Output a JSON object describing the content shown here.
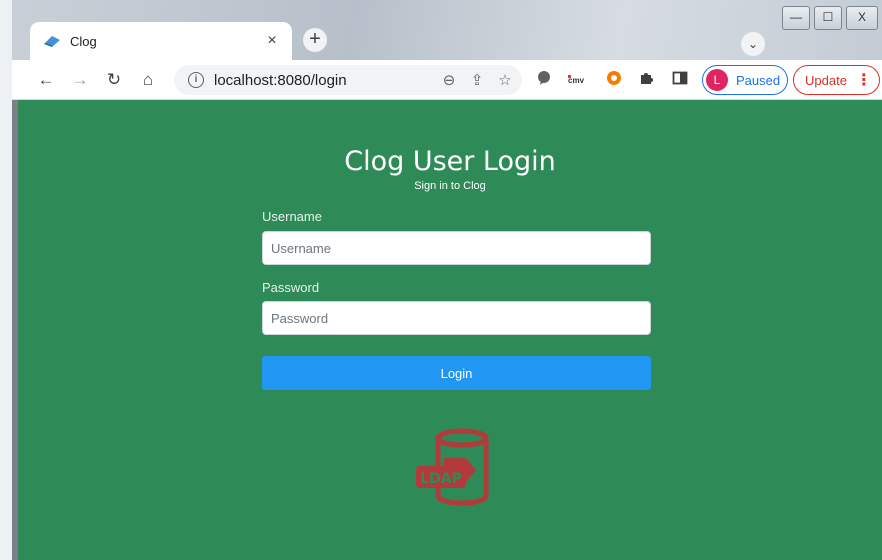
{
  "browser": {
    "tab_title": "Clog",
    "tab_close": "×",
    "new_tab": "+",
    "tab_search": "⌄",
    "window_controls": {
      "minimize": "—",
      "maximize": "☐",
      "close": "X"
    },
    "url": "localhost:8080/login",
    "profile": {
      "initial": "L",
      "label": "Paused"
    },
    "update_label": "Update",
    "icons": [
      "back-icon",
      "forward-icon",
      "reload-icon",
      "home-icon",
      "info-icon",
      "zoom-out-icon",
      "share-icon",
      "bookmark-star-icon",
      "extensions-icon",
      "side-panel-icon",
      "menu-icon"
    ]
  },
  "page": {
    "title": "Clog User Login",
    "subtitle": "Sign in to Clog",
    "username": {
      "label": "Username",
      "placeholder": "Username",
      "value": ""
    },
    "password": {
      "label": "Password",
      "placeholder": "Password",
      "value": ""
    },
    "login_label": "Login",
    "logo_text": "LDAP",
    "colors": {
      "background": "#2e8b57",
      "button": "#2196f3",
      "logo": "#b23a3a"
    }
  }
}
